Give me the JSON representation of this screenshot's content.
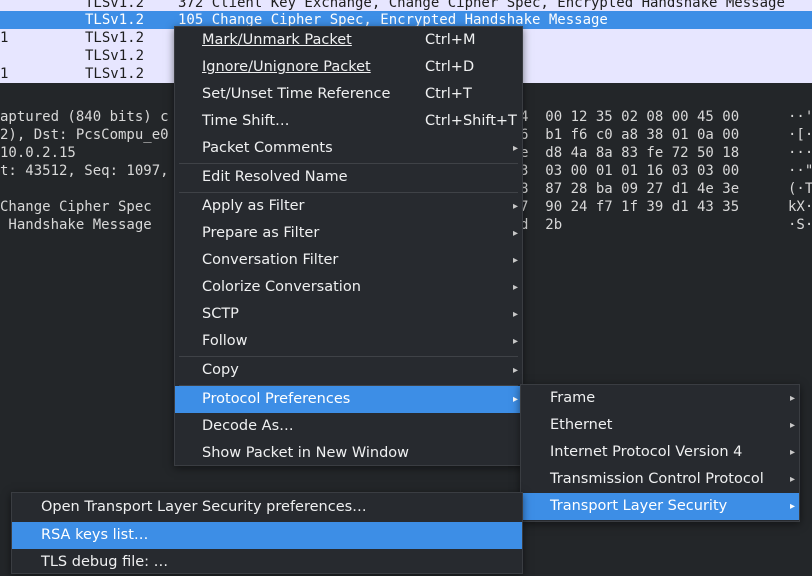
{
  "packet_list": {
    "rows": [
      {
        "no": "",
        "proto": "TLSv1.2",
        "info": "372 Client Key Exchange, Change Cipher Spec, Encrypted Handshake Message"
      },
      {
        "no": "",
        "proto": "TLSv1.2",
        "info": "105 Change Cipher Spec, Encrypted Handshake Message"
      },
      {
        "no": "1",
        "proto": "TLSv1.2",
        "info": ""
      },
      {
        "no": "",
        "proto": "TLSv1.2",
        "info": ""
      },
      {
        "no": "1",
        "proto": "TLSv1.2",
        "info": ""
      }
    ]
  },
  "detail": {
    "lines": [
      "aptured (840 bits) c",
      "2), Dst: PcsCompu_e0",
      "10.0.2.15",
      "t: 43512, Seq: 1097,",
      "",
      "Change Cipher Spec",
      " Handshake Message"
    ]
  },
  "bytes": {
    "hex": [
      "4  00 12 35 02 08 00 45 00",
      "6  b1 f6 c0 a8 38 01 0a 00",
      "e  d8 4a 8a 83 fe 72 50 18",
      "3  03 00 01 01 16 03 03 00",
      "8  87 28 ba 09 27 d1 4e 3e",
      "7  90 24 f7 1f 39 d1 43 35",
      "d  2b"
    ],
    "ascii": [
      "··'",
      "·[·",
      "···",
      "··\"",
      "(·T",
      "kX·",
      "·S·"
    ]
  },
  "context_menu": {
    "items": [
      {
        "label": "Mark/Unmark Packet",
        "shortcut": "Ctrl+M"
      },
      {
        "label": "Ignore/Unignore Packet",
        "shortcut": "Ctrl+D"
      },
      {
        "label": "Set/Unset Time Reference",
        "shortcut": "Ctrl+T"
      },
      {
        "label": "Time Shift…",
        "shortcut": "Ctrl+Shift+T"
      },
      {
        "label": "Packet Comments"
      },
      {
        "label": "Edit Resolved Name"
      },
      {
        "label": "Apply as Filter"
      },
      {
        "label": "Prepare as Filter"
      },
      {
        "label": "Conversation Filter"
      },
      {
        "label": "Colorize Conversation"
      },
      {
        "label": "SCTP"
      },
      {
        "label": "Follow"
      },
      {
        "label": "Copy"
      },
      {
        "label": "Protocol Preferences"
      },
      {
        "label": "Decode As…"
      },
      {
        "label": "Show Packet in New Window"
      }
    ],
    "submenu_arrow": "▸"
  },
  "protocol_submenu": {
    "items": [
      {
        "label": "Frame"
      },
      {
        "label": "Ethernet"
      },
      {
        "label": "Internet Protocol Version 4"
      },
      {
        "label": "Transmission Control Protocol"
      },
      {
        "label": "Transport Layer Security"
      }
    ]
  },
  "tls_submenu": {
    "items": [
      {
        "label": "Open Transport Layer Security preferences…"
      },
      {
        "label": "RSA keys list…"
      },
      {
        "label": "TLS debug file: …"
      }
    ]
  },
  "colors": {
    "selection": "#3d8ee6",
    "row_lavender": "#e7e6ff",
    "menu_bg": "#272a2f",
    "pane_bg": "#232629"
  }
}
